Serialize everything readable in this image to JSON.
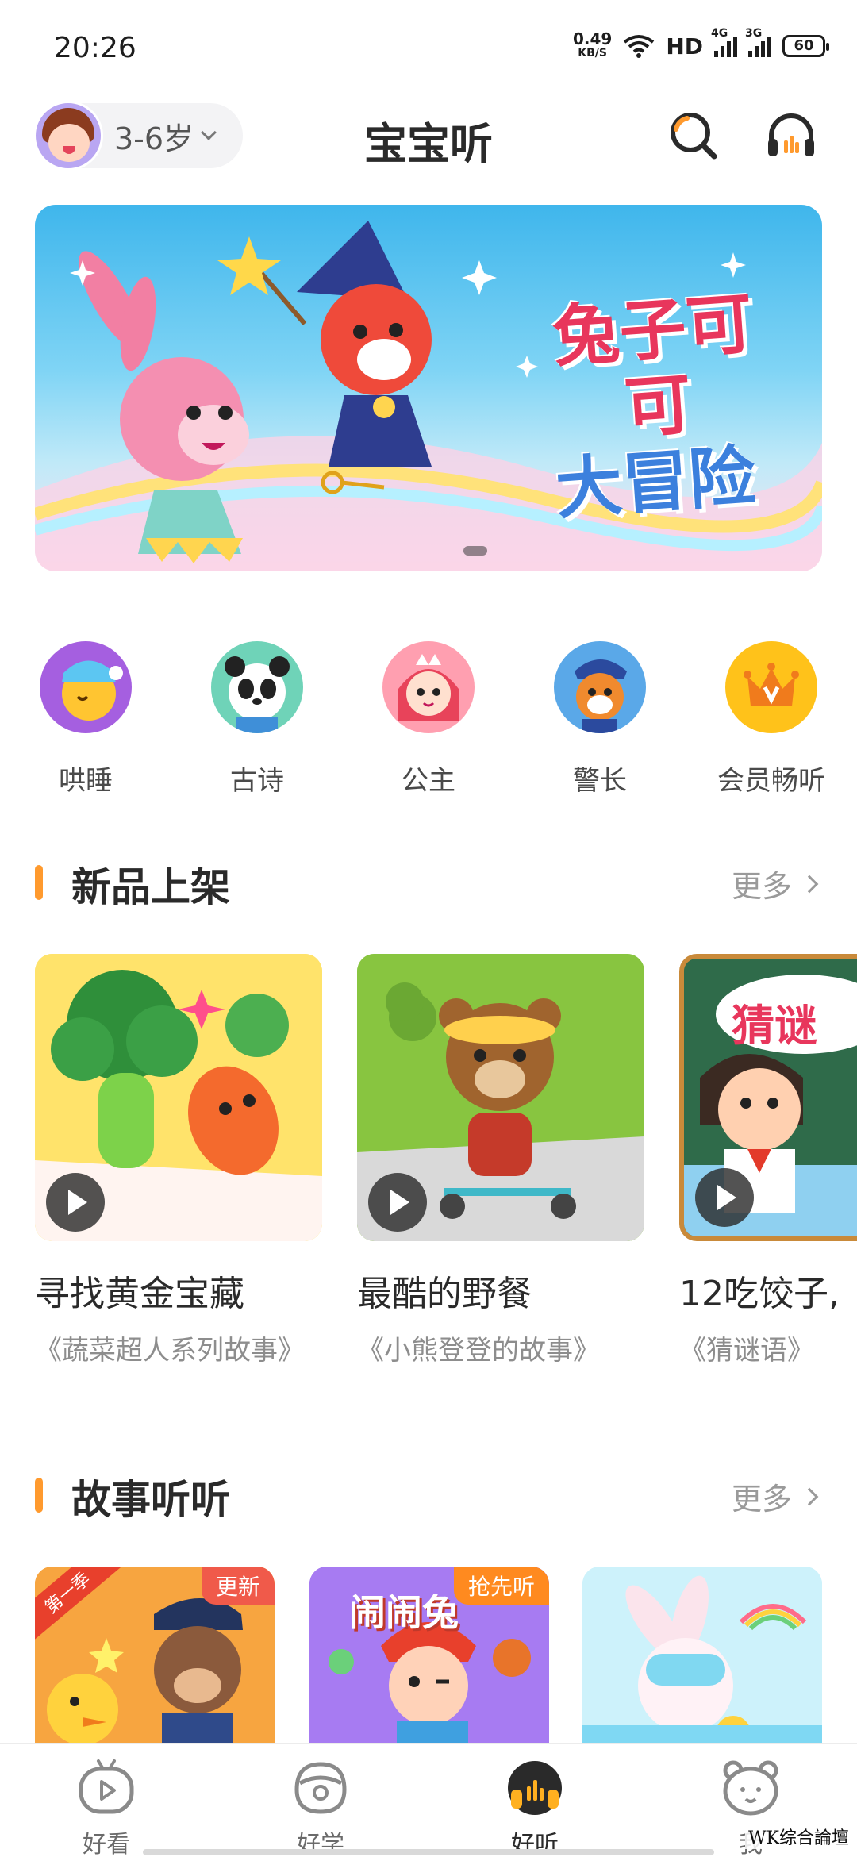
{
  "status_bar": {
    "time": "20:26",
    "net_speed": "0.49",
    "net_unit": "KB/S",
    "hd": "HD",
    "sim1": "4G",
    "sim2": "3G",
    "battery": "60"
  },
  "header": {
    "age_label": "3-6岁",
    "title": "宝宝听",
    "search_icon": "search-icon",
    "headphones_icon": "headphones-icon"
  },
  "banner": {
    "title_line1": "兔子可可",
    "title_line2": "大冒险",
    "active_index": 0
  },
  "categories": [
    {
      "label": "哄睡",
      "icon": "sleep-moon-icon",
      "color": "#a55fe0"
    },
    {
      "label": "古诗",
      "icon": "panda-icon",
      "color": "#6fd3b8"
    },
    {
      "label": "公主",
      "icon": "princess-icon",
      "color": "#ff9fb0"
    },
    {
      "label": "警长",
      "icon": "police-chief-icon",
      "color": "#5aa8e8"
    },
    {
      "label": "会员畅听",
      "icon": "crown-icon",
      "color": "#ffc21a"
    }
  ],
  "new_arrivals": {
    "title": "新品上架",
    "more": "更多",
    "items": [
      {
        "title": "寻找黄金宝藏",
        "subtitle": "《蔬菜超人系列故事》"
      },
      {
        "title": "最酷的野餐",
        "subtitle": "《小熊登登的故事》"
      },
      {
        "title": "12吃饺子,",
        "subtitle": "《猜谜语》",
        "cover_text": "猜谜"
      }
    ]
  },
  "stories": {
    "title": "故事听听",
    "more": "更多",
    "items": [
      {
        "badge": "更新",
        "corner": "第一季"
      },
      {
        "badge": "抢先听",
        "cover_text": "闹闹兔"
      },
      {
        "badge": ""
      }
    ]
  },
  "bottom_nav": [
    {
      "label": "好看",
      "icon": "tv-play-icon",
      "active": false
    },
    {
      "label": "好学",
      "icon": "learn-face-icon",
      "active": false
    },
    {
      "label": "好听",
      "icon": "headphone-music-icon",
      "active": true
    },
    {
      "label": "我",
      "icon": "bear-face-icon",
      "active": false
    }
  ],
  "watermark": "WK综合論壇",
  "colors": {
    "accent": "#ff9a2e",
    "active_nav": "#2a2a2a",
    "badge_red": "#f05a4a",
    "badge_orange": "#ff8a1f"
  }
}
